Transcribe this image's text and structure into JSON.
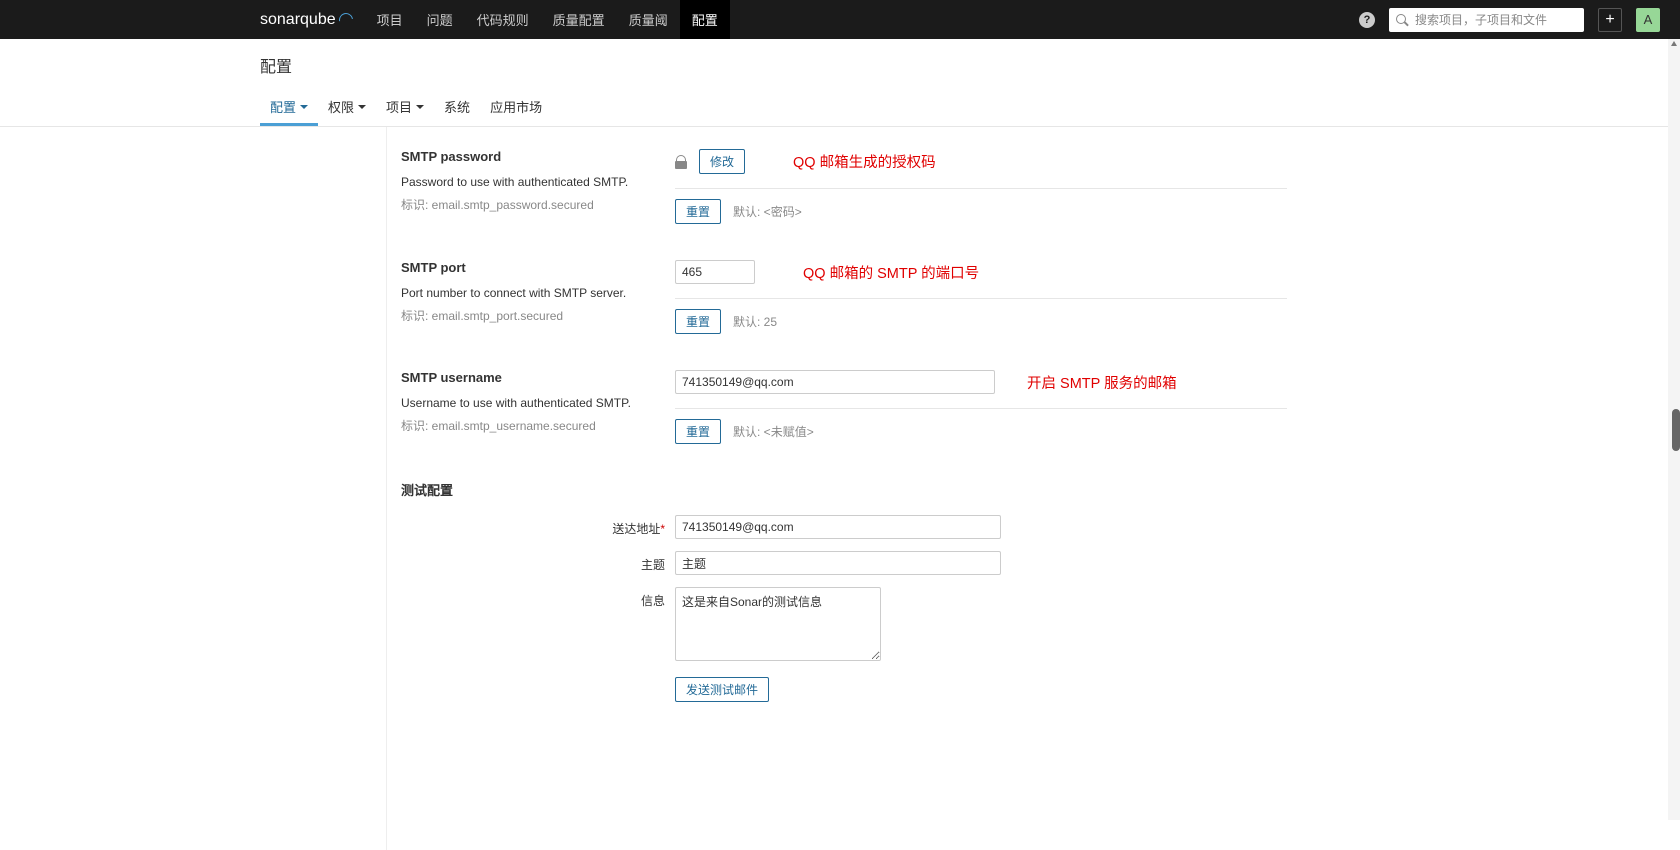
{
  "brand": {
    "left": "sonar",
    "right": "qube"
  },
  "topnav": {
    "items": [
      "项目",
      "问题",
      "代码规则",
      "质量配置",
      "质量阈",
      "配置"
    ],
    "active": 5
  },
  "search": {
    "placeholder": "搜索项目，子项目和文件"
  },
  "avatar": {
    "initial": "A"
  },
  "pagehead": {
    "title": "配置"
  },
  "subnav": {
    "items": [
      {
        "label": "配置",
        "caret": true
      },
      {
        "label": "权限",
        "caret": true
      },
      {
        "label": "项目",
        "caret": true
      },
      {
        "label": "系统",
        "caret": false
      },
      {
        "label": "应用市场",
        "caret": false
      }
    ],
    "active": 0
  },
  "actions": {
    "modify": "修改",
    "reset": "重置",
    "send_test": "发送测试邮件"
  },
  "props": {
    "smtp_password": {
      "title": "SMTP password",
      "desc": "Password to use with authenticated SMTP.",
      "key": "标识: email.smtp_password.secured",
      "annotation": "QQ 邮箱生成的授权码",
      "default": "默认: <密码>"
    },
    "smtp_port": {
      "title": "SMTP port",
      "desc": "Port number to connect with SMTP server.",
      "key": "标识: email.smtp_port.secured",
      "value": "465",
      "annotation": "QQ 邮箱的 SMTP 的端口号",
      "default": "默认: 25"
    },
    "smtp_username": {
      "title": "SMTP username",
      "desc": "Username to use with authenticated SMTP.",
      "key": "标识: email.smtp_username.secured",
      "value": "741350149@qq.com",
      "annotation": "开启 SMTP 服务的邮箱",
      "default": "默认: <未赋值>"
    }
  },
  "test": {
    "section_title": "测试配置",
    "to_label": "送达地址",
    "to_value": "741350149@qq.com",
    "subject_label": "主题",
    "subject_value": "主题",
    "message_label": "信息",
    "message_value": "这是来自Sonar的测试信息"
  }
}
